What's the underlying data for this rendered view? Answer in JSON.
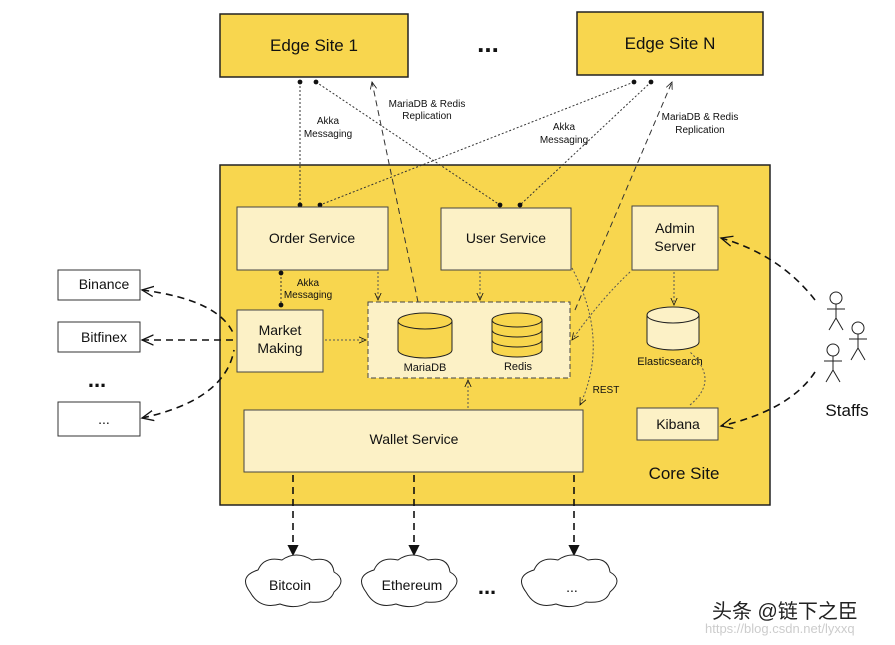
{
  "colors": {
    "core": "#F8D64E",
    "box": "#FCF1C6",
    "edge": "#F8D64E",
    "stroke": "#222222"
  },
  "edge_sites": {
    "site1": "Edge Site 1",
    "ellipsis": "...",
    "siteN": "Edge Site N"
  },
  "edge_links": {
    "akka1": [
      "Akka",
      "Messaging"
    ],
    "repl1": [
      "MariaDB & Redis",
      "Replication"
    ],
    "akka2": [
      "Akka",
      "Messaging"
    ],
    "repl2": [
      "MariaDB & Redis",
      "Replication"
    ]
  },
  "core": {
    "label": "Core Site",
    "order_service": "Order Service",
    "user_service": "User Service",
    "admin_server": [
      "Admin",
      "Server"
    ],
    "market_making": [
      "Market",
      "Making"
    ],
    "akka_label": [
      "Akka",
      "Messaging"
    ],
    "mariadb": "MariaDB",
    "redis": "Redis",
    "elasticsearch": "Elasticsearch",
    "kibana": "Kibana",
    "wallet_service": "Wallet Service",
    "rest": "REST"
  },
  "exchanges": [
    "Binance",
    "Bitfinex",
    "...",
    "..."
  ],
  "staffs": "Staffs",
  "chains": [
    "Bitcoin",
    "Ethereum",
    "...",
    "..."
  ],
  "watermark": {
    "line1": "头条 @链下之臣",
    "line2": "https://blog.csdn.net/lyxxq"
  }
}
